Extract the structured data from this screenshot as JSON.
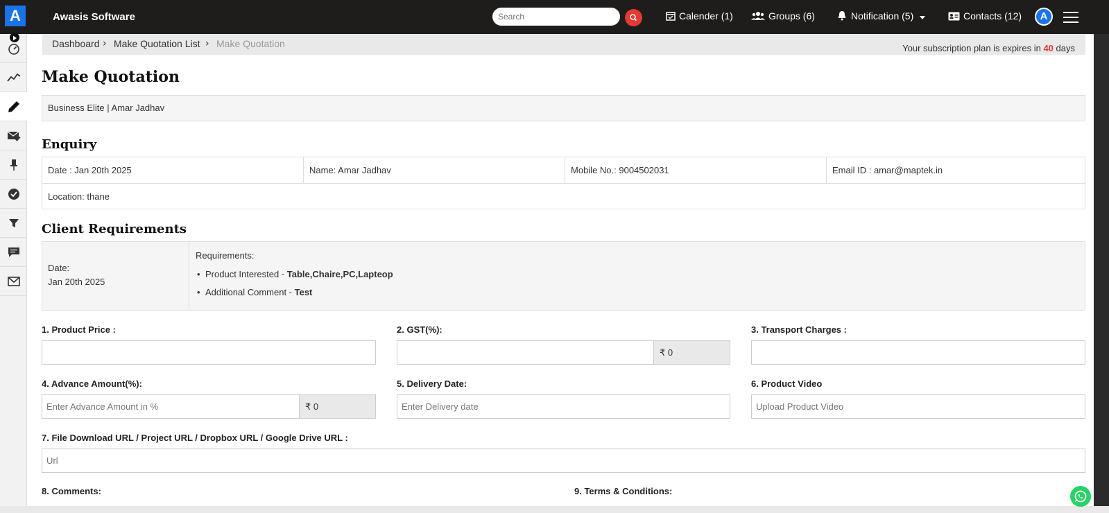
{
  "header": {
    "logo_letter": "A",
    "app_title": "Awasis Software",
    "search_placeholder": "Search",
    "nav": {
      "calendar": "Calender (1)",
      "groups": "Groups (6)",
      "notification": "Notification (5)",
      "contacts": "Contacts (12)"
    },
    "avatar_letter": "A"
  },
  "breadcrumb": {
    "items": [
      "Dashboard",
      "Make Quotation List",
      "Make Quotation"
    ],
    "subscription_prefix": "Your subscription plan is expires in",
    "subscription_days": "40",
    "subscription_suffix": "days"
  },
  "page_title": "Make Quotation",
  "business_line": "Business Elite | Amar Jadhav",
  "enquiry": {
    "title": "Enquiry",
    "date": "Date : Jan 20th 2025",
    "name": "Name: Amar Jadhav",
    "mobile": "Mobile No.: 9004502031",
    "email": "Email ID : amar@maptek.in",
    "location": "Location: thane"
  },
  "client_requirements": {
    "title": "Client Requirements",
    "date_label": "Date:",
    "date_value": "Jan 20th 2025",
    "requirements_label": "Requirements:",
    "product_label": "Product Interested - ",
    "product_value": "Table,Chaire,PC,Lapteop",
    "comment_label": "Additional Comment - ",
    "comment_value": "Test"
  },
  "form": {
    "product_price_label": "1. Product Price :",
    "gst_label": "2. GST(%):",
    "gst_addon": "₹ 0",
    "transport_label": "3. Transport Charges :",
    "advance_label": "4. Advance Amount(%):",
    "advance_placeholder": "Enter Advance Amount in %",
    "advance_addon": "₹ 0",
    "delivery_label": "5. Delivery Date:",
    "delivery_placeholder": "Enter Delivery date",
    "video_label": "6. Product Video",
    "video_placeholder": "Upload Product Video",
    "url_label": "7. File Download URL / Project URL / Dropbox URL / Google Drive URL :",
    "url_placeholder": "Url",
    "comments_label": "8. Comments:",
    "terms_label": "9. Terms & Conditions:"
  },
  "colors": {
    "topbar": "#1f1d1b",
    "accent_blue": "#1a73e8",
    "accent_red": "#e53935",
    "whatsapp_green": "#25d366"
  },
  "icons": {
    "sidebar": [
      "speedometer-icon",
      "chart-line-icon",
      "pencil-icon",
      "mail-check-icon",
      "pin-icon",
      "check-circle-icon",
      "filter-icon",
      "message-icon",
      "envelope-icon"
    ]
  }
}
